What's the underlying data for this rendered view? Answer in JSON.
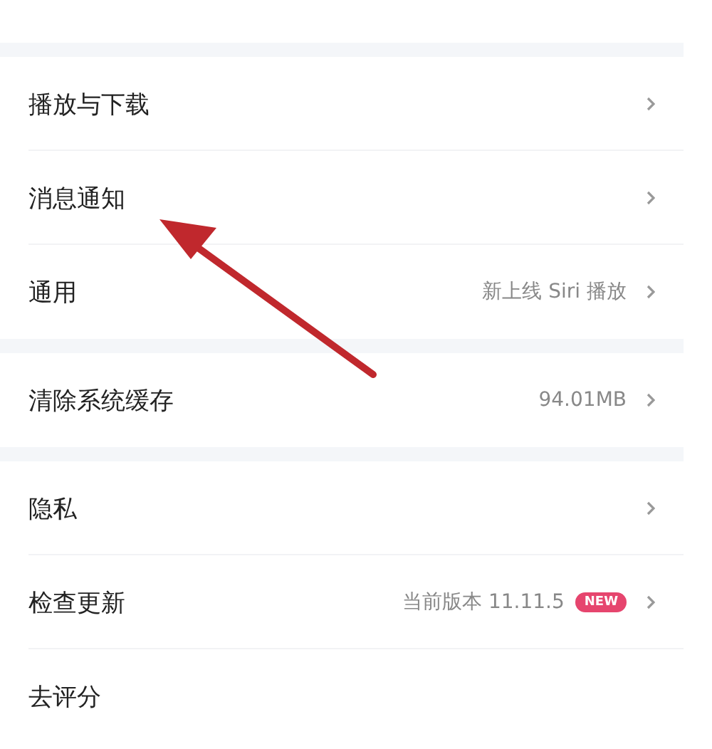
{
  "sections": [
    {
      "rows": [
        {
          "label": "播放与下载",
          "chevron": true
        },
        {
          "label": "消息通知",
          "chevron": true
        },
        {
          "label": "通用",
          "detail": "新上线 Siri 播放",
          "chevron": true
        }
      ]
    },
    {
      "rows": [
        {
          "label": "清除系统缓存",
          "detail": "94.01MB",
          "chevron": true
        }
      ]
    },
    {
      "rows": [
        {
          "label": "隐私",
          "chevron": true
        },
        {
          "label": "检查更新",
          "detail": "当前版本 11.11.5",
          "badge": "NEW",
          "chevron": true
        },
        {
          "label": "去评分",
          "chevron": false
        }
      ]
    }
  ]
}
